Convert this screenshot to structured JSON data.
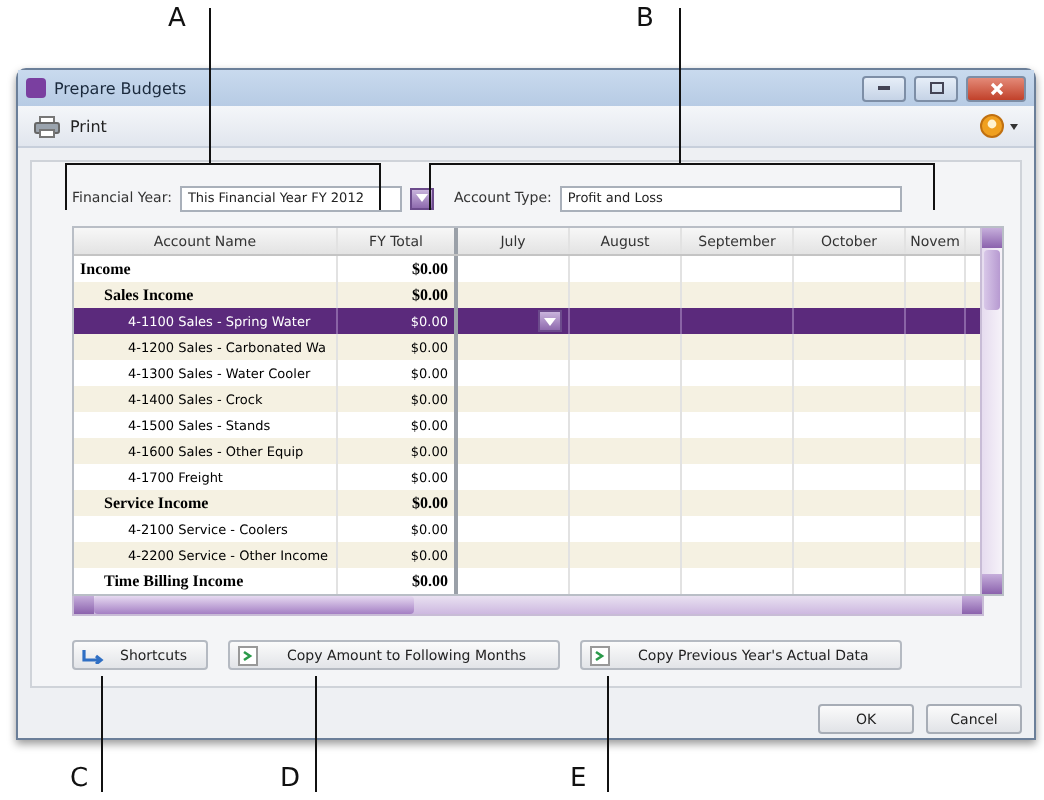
{
  "window": {
    "title": "Prepare Budgets"
  },
  "toolbar": {
    "print": "Print"
  },
  "filters": [
    {
      "label": "Financial Year:",
      "value": "This Financial Year FY 2012"
    },
    {
      "label": "Account Type:",
      "value": "Profit and Loss"
    }
  ],
  "table": {
    "columns": [
      "Account Name",
      "FY Total",
      "July",
      "August",
      "September",
      "October",
      "Novem"
    ],
    "rows": [
      {
        "name": "Income",
        "total": "$0.00",
        "kind": "header",
        "selected": false,
        "children": [
          {
            "name": "Sales Income",
            "total": "$0.00",
            "kind": "header",
            "selected": false,
            "children": [
              {
                "name": "4-1100 Sales - Spring Water",
                "total": "$0.00",
                "kind": "account",
                "selected": true
              },
              {
                "name": "4-1200 Sales - Carbonated Wa",
                "total": "$0.00",
                "kind": "account",
                "selected": false
              },
              {
                "name": "4-1300 Sales - Water Cooler",
                "total": "$0.00",
                "kind": "account",
                "selected": false
              },
              {
                "name": "4-1400 Sales - Crock",
                "total": "$0.00",
                "kind": "account",
                "selected": false
              },
              {
                "name": "4-1500 Sales - Stands",
                "total": "$0.00",
                "kind": "account",
                "selected": false
              },
              {
                "name": "4-1600 Sales - Other Equip",
                "total": "$0.00",
                "kind": "account",
                "selected": false
              },
              {
                "name": "4-1700 Freight",
                "total": "$0.00",
                "kind": "account",
                "selected": false
              }
            ]
          },
          {
            "name": "Service Income",
            "total": "$0.00",
            "kind": "header",
            "selected": false,
            "children": [
              {
                "name": "4-2100 Service - Coolers",
                "total": "$0.00",
                "kind": "account",
                "selected": false
              },
              {
                "name": "4-2200 Service - Other Income",
                "total": "$0.00",
                "kind": "account",
                "selected": false
              }
            ]
          },
          {
            "name": "Time Billing Income",
            "total": "$0.00",
            "kind": "header",
            "selected": false
          }
        ]
      }
    ]
  },
  "actions": [
    {
      "label": "Shortcuts",
      "kind": "shortcuts"
    },
    {
      "label": "Copy Amount to Following Months",
      "kind": "copy"
    },
    {
      "label": "Copy Previous Year's Actual Data",
      "kind": "copy"
    }
  ],
  "dialog_buttons": [
    "OK",
    "Cancel"
  ],
  "callouts": [
    {
      "label": "A"
    },
    {
      "label": "B"
    },
    {
      "label": "C"
    },
    {
      "label": "D"
    },
    {
      "label": "E"
    }
  ]
}
